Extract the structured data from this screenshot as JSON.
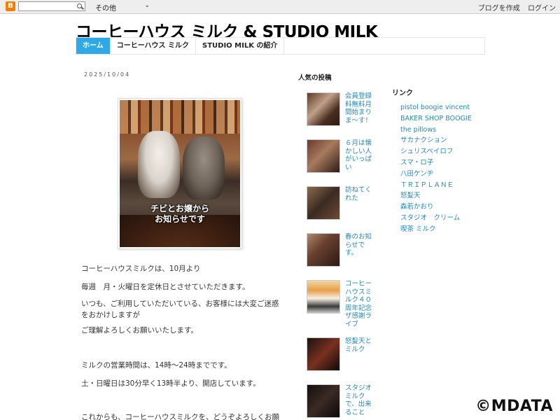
{
  "navbar": {
    "logo": "B",
    "search_value": "",
    "select_value": "その他",
    "create_blog": "ブログを作成",
    "login": "ログイン"
  },
  "header": {
    "title": "コーヒーハウス ミルク & STUDIO MILK"
  },
  "tabs": [
    {
      "label": "ホーム"
    },
    {
      "label": "コーヒーハウス ミルク"
    },
    {
      "label": "STUDIO MILK の紹介"
    }
  ],
  "post": {
    "date": "2025/10/04",
    "image_caption_line1": "チビとお嬢から",
    "image_caption_line2": "お知らせです",
    "paragraphs": [
      "コーヒーハウスミルクは、10月より",
      "毎週　月・火曜日を定休日とさせていただきます。",
      "いつも、ご利用していただいている、お客様には大変ご迷惑をおかけしますが",
      "ご理解よろしくお願いいたします。",
      "ミルクの営業時間は、14時〜24時までです。",
      "土・日曜日は30分早く13時半より、開店しています。",
      "これからも、コーヒーハウスミルクを、どうぞよろしくお願"
    ]
  },
  "popular": {
    "title": "人気の投稿",
    "items": [
      {
        "label": "会員登録料無料月間始まりま〜す！"
      },
      {
        "label": "６月は懐かしい人がいっぱい"
      },
      {
        "label": "訪ねてくれた"
      },
      {
        "label": "春のお知らせです。"
      },
      {
        "label": "コーヒーハウスミルク４０周年記念ザ感謝ライブ"
      },
      {
        "label": "怒髪天とミルク"
      },
      {
        "label": "スタジオミルクで、出来ること"
      }
    ]
  },
  "links": {
    "title": "リンク",
    "items": [
      "pistol boogie vincent",
      "BAKER SHOP BOOGIE",
      "the pillows",
      "サカナクション",
      "シュリスペイロフ",
      "スマ・ロ子",
      "八田ケンヂ",
      "ＴＲＩＰＬＡＮＥ",
      "怒髪天",
      "森若かおり",
      "スタジオ　クリーム",
      "喫茶 ミルク"
    ]
  },
  "watermark": "©MDATA",
  "colors": {
    "accent": "#2ea9e5",
    "link": "#2288bb",
    "blogger_orange": "#f57d00"
  }
}
